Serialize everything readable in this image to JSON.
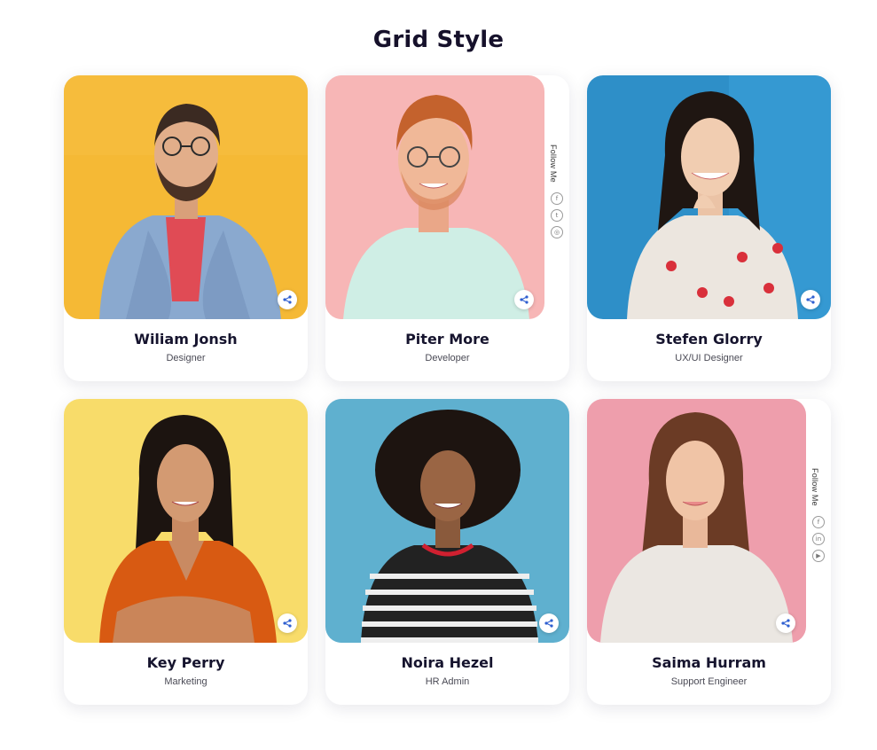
{
  "page": {
    "title": "Grid Style"
  },
  "team": [
    {
      "name": "Wiliam Jonsh",
      "role": "Designer",
      "bg": "#f5b935"
    },
    {
      "name": "Piter More",
      "role": "Developer",
      "bg": "#f7b6b6",
      "follow_label": "Follow Me",
      "socials": [
        "facebook-icon",
        "twitter-icon",
        "instagram-icon"
      ]
    },
    {
      "name": "Stefen Glorry",
      "role": "UX/UI Designer",
      "bg": "#2e8fc8"
    },
    {
      "name": "Key Perry",
      "role": "Marketing",
      "bg": "#f8dc6a"
    },
    {
      "name": "Noira Hezel",
      "role": "HR Admin",
      "bg": "#5fb0cf"
    },
    {
      "name": "Saima Hurram",
      "role": "Support Engineer",
      "bg": "#ee9eac",
      "follow_label": "Follow Me",
      "socials": [
        "facebook-icon",
        "linkedin-icon",
        "youtube-icon"
      ]
    }
  ],
  "colors": {
    "accent": "#2f5fd0",
    "heading": "#16142e"
  }
}
